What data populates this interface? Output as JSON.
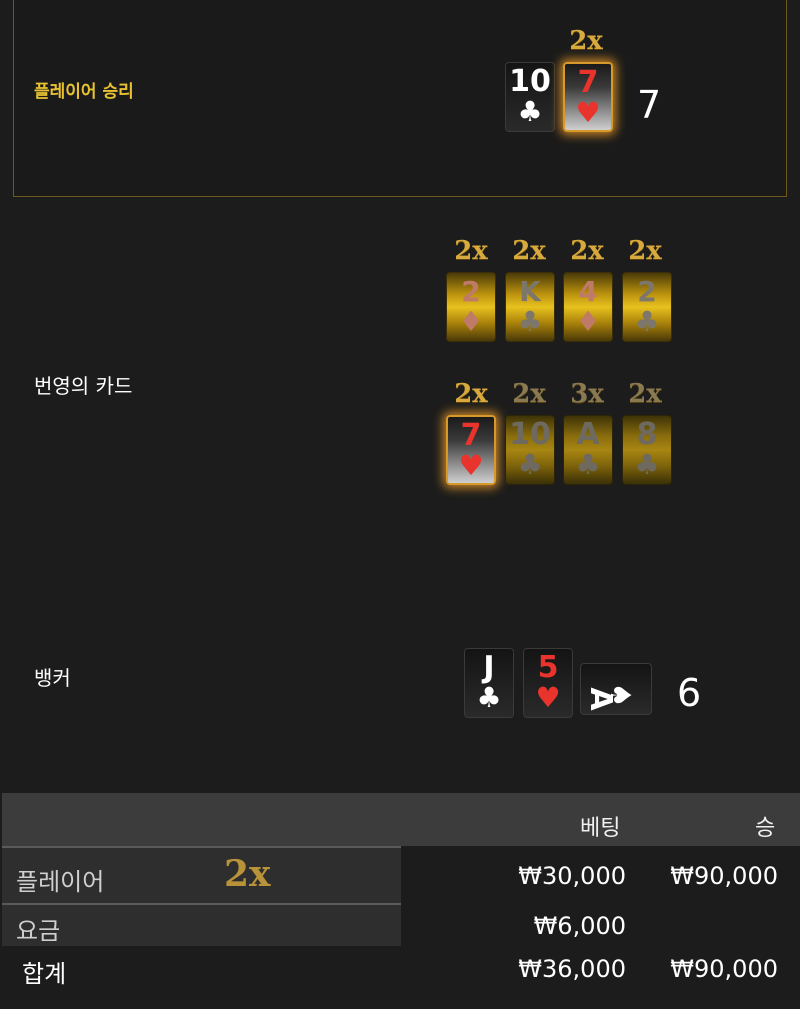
{
  "player": {
    "label": "플레이어 승리",
    "multiplier": "2x",
    "score": "7",
    "cards": [
      {
        "rank": "10",
        "suit": "♣"
      },
      {
        "rank": "7",
        "suit": "♥"
      }
    ]
  },
  "lightning": {
    "label": "번영의 카드",
    "row1": [
      {
        "mult": "2x",
        "rank": "2",
        "suit": "♦"
      },
      {
        "mult": "2x",
        "rank": "K",
        "suit": "♣"
      },
      {
        "mult": "2x",
        "rank": "4",
        "suit": "♦"
      },
      {
        "mult": "2x",
        "rank": "2",
        "suit": "♣"
      }
    ],
    "row2": [
      {
        "mult": "2x",
        "rank": "7",
        "suit": "♥"
      },
      {
        "mult": "2x",
        "rank": "10",
        "suit": "♣"
      },
      {
        "mult": "3x",
        "rank": "A",
        "suit": "♣"
      },
      {
        "mult": "2x",
        "rank": "8",
        "suit": "♣"
      }
    ]
  },
  "banker": {
    "label": "뱅커",
    "score": "6",
    "cards": [
      {
        "rank": "J",
        "suit": "♣"
      },
      {
        "rank": "5",
        "suit": "♥"
      },
      {
        "rank": "A",
        "suit": "♠"
      }
    ]
  },
  "table": {
    "headers": {
      "bet": "베팅",
      "win": "승"
    },
    "rows": [
      {
        "label": "플레이어",
        "multiplier": "2x",
        "bet": "₩30,000",
        "win": "₩90,000"
      },
      {
        "label": "요금",
        "bet": "₩6,000",
        "win": ""
      },
      {
        "label": "합계",
        "bet": "₩36,000",
        "win": "₩90,000"
      }
    ]
  },
  "colors": {
    "gold": "#d8a93c",
    "player_label": "#e8c232",
    "red_suit": "#e8342c"
  }
}
